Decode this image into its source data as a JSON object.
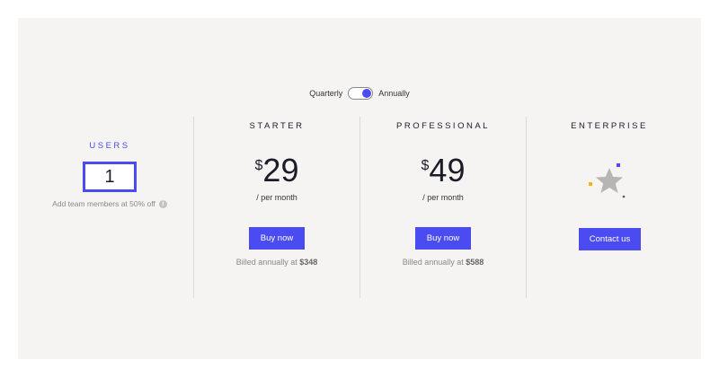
{
  "billing_toggle": {
    "left_label": "Quarterly",
    "right_label": "Annually",
    "selected": "Annually"
  },
  "users": {
    "title": "USERS",
    "count": "1",
    "note": "Add team members at 50% off",
    "info_icon": "info-icon"
  },
  "plans": [
    {
      "name": "STARTER",
      "currency": "$",
      "price": "29",
      "period": "/ per month",
      "button": "Buy now",
      "billed_prefix": "Billed annually at",
      "billed_amount": "$348"
    },
    {
      "name": "PROFESSIONAL",
      "currency": "$",
      "price": "49",
      "period": "/ per month",
      "button": "Buy now",
      "billed_prefix": "Billed annually at",
      "billed_amount": "$588"
    },
    {
      "name": "ENTERPRISE",
      "icon": "star-icon",
      "button": "Contact us"
    }
  ],
  "colors": {
    "accent": "#4a4cf2",
    "panel_bg": "#f5f4f3",
    "star": "#b7b5b3",
    "confetti_yellow": "#f2b705"
  }
}
